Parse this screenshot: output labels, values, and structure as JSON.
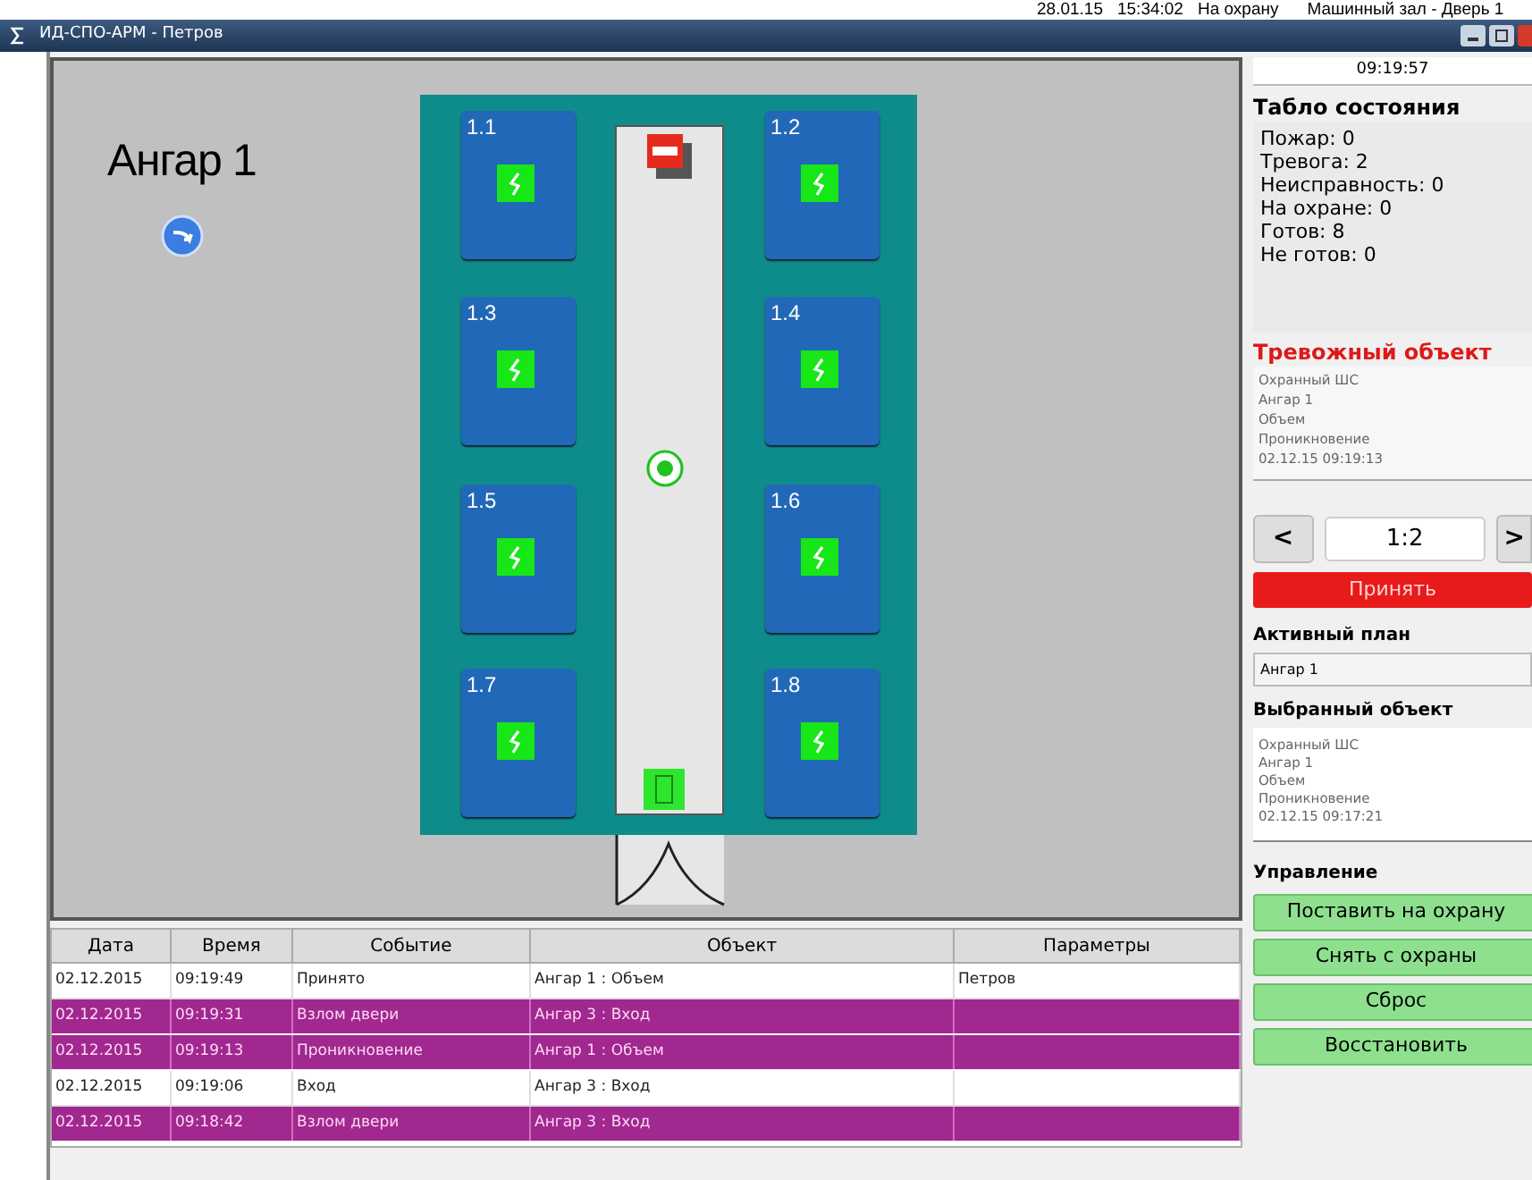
{
  "background_window": {
    "date": "28.01.15",
    "time": "15:34:02",
    "event": "На охрану",
    "object": "Машинный зал - Дверь 1"
  },
  "window": {
    "title": "ИД-СПО-АРМ - Петров"
  },
  "plan": {
    "title": "Ангар 1",
    "zones": [
      {
        "label": "1.1"
      },
      {
        "label": "1.2"
      },
      {
        "label": "1.3"
      },
      {
        "label": "1.4"
      },
      {
        "label": "1.5"
      },
      {
        "label": "1.6"
      },
      {
        "label": "1.7"
      },
      {
        "label": "1.8"
      }
    ]
  },
  "events": {
    "columns": [
      "Дата",
      "Время",
      "Событие",
      "Объект",
      "Параметры"
    ],
    "rows": [
      {
        "alarm": false,
        "cells": [
          "02.12.2015",
          "09:19:49",
          "Принято",
          "Ангар 1 : Объем",
          "Петров"
        ]
      },
      {
        "alarm": true,
        "cells": [
          "02.12.2015",
          "09:19:31",
          "Взлом двери",
          "Ангар 3 : Вход",
          ""
        ]
      },
      {
        "alarm": true,
        "cells": [
          "02.12.2015",
          "09:19:13",
          "Проникновение",
          "Ангар 1 : Объем",
          ""
        ]
      },
      {
        "alarm": false,
        "cells": [
          "02.12.2015",
          "09:19:06",
          "Вход",
          "Ангар 3 : Вход",
          ""
        ]
      },
      {
        "alarm": true,
        "cells": [
          "02.12.2015",
          "09:18:42",
          "Взлом двери",
          "Ангар 3 : Вход",
          ""
        ]
      }
    ]
  },
  "sidebar": {
    "clock": "09:19:57",
    "status_title": "Табло состояния",
    "counters": [
      "Пожар: 0",
      "Тревога: 2",
      "Неисправность: 0",
      "На охране: 0",
      "Готов: 8",
      "Не готов: 0"
    ],
    "alarm_title": "Тревожный объект",
    "alarm_details": [
      "Охранный ШС",
      "Ангар 1",
      "Объем",
      "Проникновение",
      "02.12.15 09:19:13"
    ],
    "prev": "<",
    "page": "1:2",
    "next": ">",
    "accept": "Принять",
    "plan_title": "Активный план",
    "plan_value": "Ангар 1",
    "selected_title": "Выбранный объект",
    "selected_details": [
      "Охранный ШС",
      "Ангар 1",
      "Объем",
      "Проникновение",
      "02.12.15 09:17:21"
    ],
    "control_title": "Управление",
    "actions": [
      "Поставить на охрану",
      "Снять с охраны",
      "Сброс",
      "Восстановить"
    ]
  }
}
